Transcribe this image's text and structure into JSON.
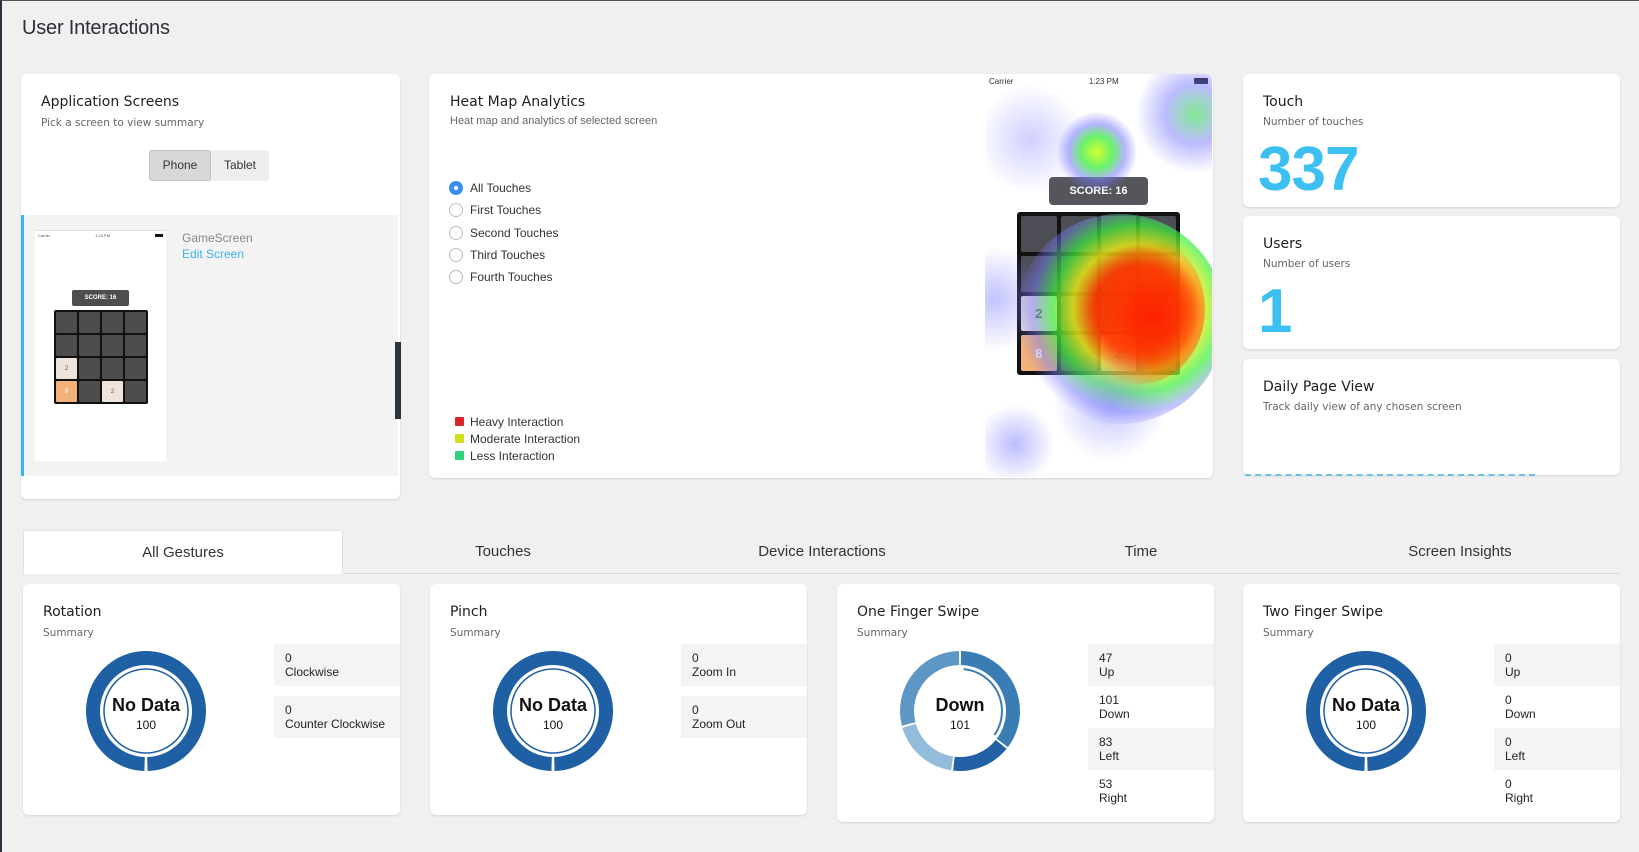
{
  "page": {
    "title": "User Interactions"
  },
  "app_screens": {
    "title": "Application Screens",
    "subtitle": "Pick a screen to view summary",
    "device_toggle": {
      "options": [
        "Phone",
        "Tablet"
      ],
      "selected": "Phone"
    },
    "screens": [
      {
        "name": "GameScreen",
        "edit_label": "Edit Screen",
        "thumbnail": {
          "status_left": "Carrier",
          "status_time": "1:23 PM",
          "score": "SCORE: 16",
          "grid": [
            [
              "",
              "",
              "",
              ""
            ],
            [
              "",
              "",
              "",
              ""
            ],
            [
              "2",
              "",
              "",
              ""
            ],
            [
              "8",
              "",
              "2",
              ""
            ]
          ]
        }
      }
    ]
  },
  "heatmap": {
    "title": "Heat Map Analytics",
    "subtitle": "Heat map and analytics of selected screen",
    "filters": [
      "All Touches",
      "First Touches",
      "Second Touches",
      "Third Touches",
      "Fourth Touches"
    ],
    "selected_filter": "All Touches",
    "legend": [
      {
        "label": "Heavy Interaction",
        "color": "#d9242a"
      },
      {
        "label": "Moderate Interaction",
        "color": "#cfe01a"
      },
      {
        "label": "Less Interaction",
        "color": "#2fd47a"
      }
    ],
    "phone": {
      "status_left": "Carrier",
      "status_time": "1:23 PM",
      "score": "SCORE: 16",
      "grid": [
        [
          "",
          "",
          "",
          ""
        ],
        [
          "",
          "",
          "",
          ""
        ],
        [
          "2",
          "",
          "",
          ""
        ],
        [
          "8",
          "",
          "2",
          ""
        ]
      ]
    }
  },
  "stats": {
    "touch": {
      "title": "Touch",
      "subtitle": "Number of touches",
      "value": "337"
    },
    "users": {
      "title": "Users",
      "subtitle": "Number of users",
      "value": "1"
    },
    "daily": {
      "title": "Daily Page View",
      "subtitle": "Track daily view of any chosen screen"
    }
  },
  "tabs": {
    "items": [
      "All Gestures",
      "Touches",
      "Device Interactions",
      "Time",
      "Screen Insights"
    ],
    "active": "All Gestures"
  },
  "gestures": [
    {
      "title": "Rotation",
      "subtitle": "Summary",
      "center_label": "No Data",
      "center_value": "100",
      "items": [
        {
          "value": "0",
          "label": "Clockwise"
        },
        {
          "value": "0",
          "label": "Counter Clockwise"
        }
      ]
    },
    {
      "title": "Pinch",
      "subtitle": "Summary",
      "center_label": "No Data",
      "center_value": "100",
      "items": [
        {
          "value": "0",
          "label": "Zoom In"
        },
        {
          "value": "0",
          "label": "Zoom Out"
        }
      ]
    },
    {
      "title": "One Finger Swipe",
      "subtitle": "Summary",
      "center_label": "Down",
      "center_value": "101",
      "items": [
        {
          "value": "47",
          "label": "Up"
        },
        {
          "value": "101",
          "label": "Down"
        },
        {
          "value": "83",
          "label": "Left"
        },
        {
          "value": "53",
          "label": "Right"
        }
      ]
    },
    {
      "title": "Two Finger Swipe",
      "subtitle": "Summary",
      "center_label": "No Data",
      "center_value": "100",
      "items": [
        {
          "value": "0",
          "label": "Up"
        },
        {
          "value": "0",
          "label": "Down"
        },
        {
          "value": "0",
          "label": "Left"
        },
        {
          "value": "0",
          "label": "Right"
        }
      ]
    }
  ],
  "chart_data": [
    {
      "type": "pie",
      "title": "Rotation",
      "categories": [
        "No Data"
      ],
      "values": [
        100
      ],
      "center_text": "No Data"
    },
    {
      "type": "pie",
      "title": "Pinch",
      "categories": [
        "No Data"
      ],
      "values": [
        100
      ],
      "center_text": "No Data"
    },
    {
      "type": "pie",
      "title": "One Finger Swipe",
      "categories": [
        "Down",
        "Up",
        "Right",
        "Left"
      ],
      "values": [
        101,
        47,
        53,
        83
      ],
      "highlighted": "Down",
      "colors": [
        "#3a7db5",
        "#2360a5",
        "#93bcdb",
        "#5e97c6"
      ]
    },
    {
      "type": "pie",
      "title": "Two Finger Swipe",
      "categories": [
        "No Data"
      ],
      "values": [
        100
      ],
      "center_text": "No Data"
    }
  ],
  "colors": {
    "accent": "#3bb3f0",
    "big_number": "#3cc0f2",
    "donut_empty": "#1f5fa3",
    "radio_selected": "#3b8ff0"
  }
}
